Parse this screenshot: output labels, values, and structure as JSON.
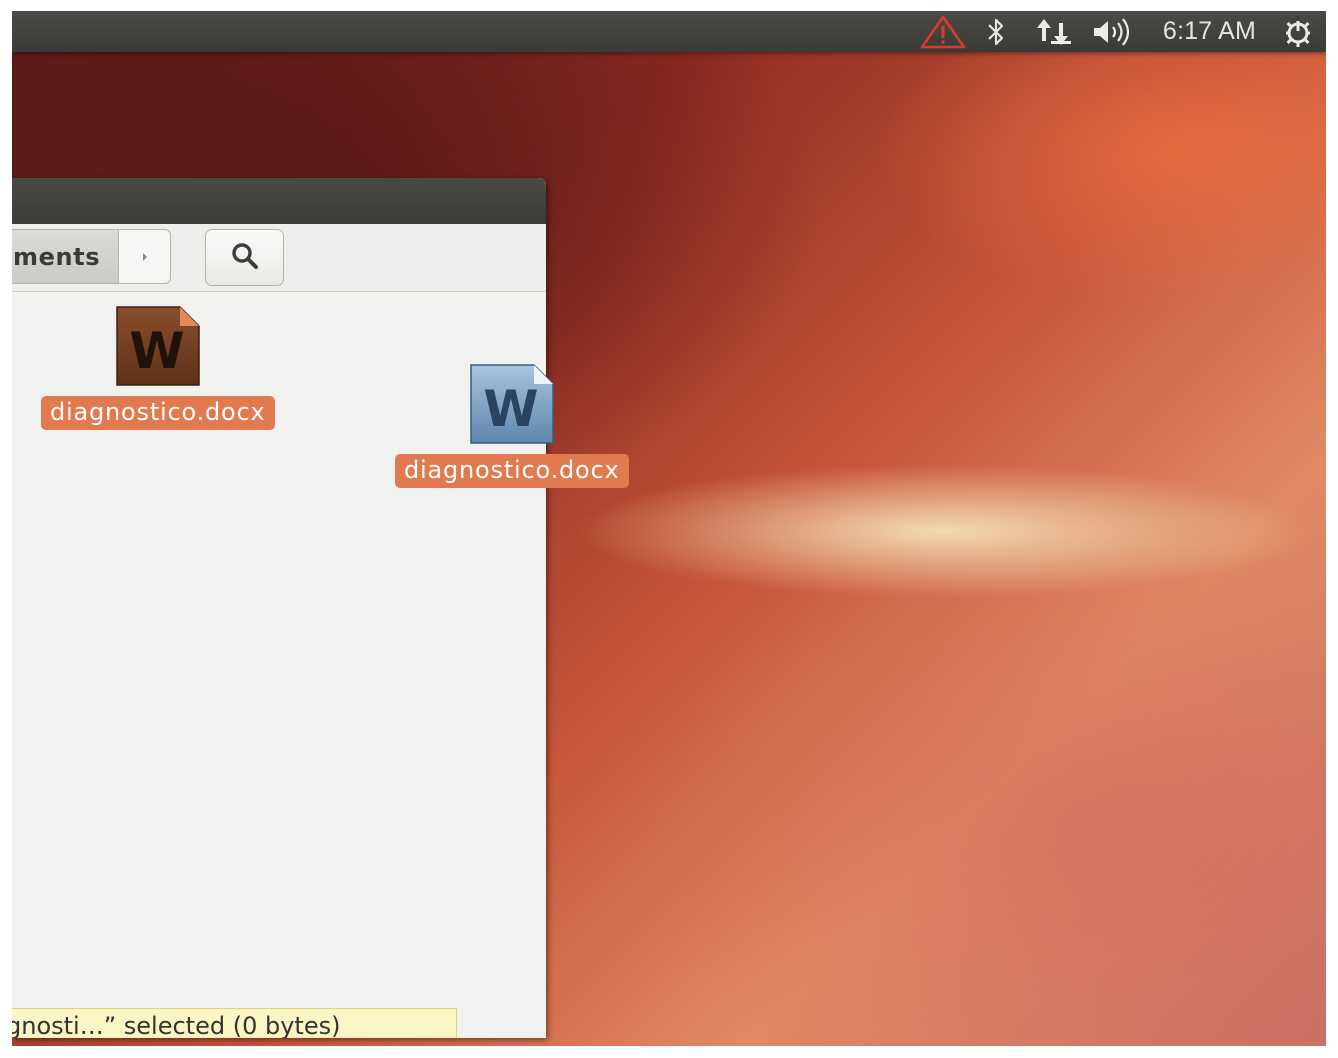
{
  "top_panel": {
    "indicators": [
      {
        "icon": "warning-icon",
        "color": "#d63b2c"
      },
      {
        "icon": "bluetooth-icon"
      },
      {
        "icon": "network-transfer-icon"
      },
      {
        "icon": "volume-icon"
      }
    ],
    "clock": "6:17 AM",
    "session_icon": "power-gear-icon"
  },
  "file_manager": {
    "breadcrumb": {
      "label": "ments"
    },
    "search": {
      "icon": "search-icon"
    },
    "files": [
      {
        "name": "diagnostico.docx",
        "icon": "word-document-icon",
        "selected": true
      }
    ],
    "status": "gnosti…” selected  (0 bytes)"
  },
  "drag_preview": {
    "name": "diagnostico.docx",
    "icon": "word-document-icon"
  },
  "colors": {
    "selection": "#e27a4f",
    "panel": "#3f3e3a",
    "status_bg": "#fbf5c4"
  }
}
